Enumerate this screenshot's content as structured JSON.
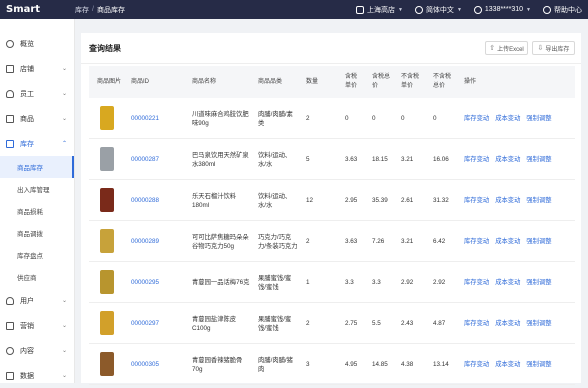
{
  "app": {
    "logo": "Smart"
  },
  "breadcrumb": [
    "库存",
    "商品库存"
  ],
  "header": {
    "store": "上海高店",
    "language": "简体中文",
    "user": "1338****310",
    "help": "帮助中心"
  },
  "sidebar": {
    "items": [
      {
        "label": "概览",
        "icon": "dashboard-icon"
      },
      {
        "label": "店铺",
        "icon": "store-icon"
      },
      {
        "label": "员工",
        "icon": "staff-icon"
      },
      {
        "label": "商品",
        "icon": "goods-icon"
      },
      {
        "label": "库存",
        "icon": "inventory-icon"
      }
    ],
    "sub_items": [
      "商品库存",
      "出入库管理",
      "商品损耗",
      "商品调拨",
      "库存盘点",
      "供应商"
    ],
    "lower_items": [
      {
        "label": "用户",
        "icon": "user-icon"
      },
      {
        "label": "营销",
        "icon": "marketing-icon"
      },
      {
        "label": "内容",
        "icon": "content-icon"
      },
      {
        "label": "数据",
        "icon": "data-icon"
      }
    ]
  },
  "main": {
    "title": "查询结果",
    "upload_label": "上传Excel",
    "export_label": "导出库存",
    "columns": [
      "商品图片",
      "商品ID",
      "商品名称",
      "商品品类",
      "数量",
      "含税\n单价",
      "含税总\n价",
      "不含税\n单价",
      "不含税\n总价",
      "操作"
    ],
    "actions": [
      "库存变动",
      "成本变动",
      "强制调整"
    ],
    "rows": [
      {
        "id": "00000221",
        "name": "川道味麻合鸡肢饮肥\n味90g",
        "category": "肉脯/肉脯/素\n类",
        "qty": "2",
        "tax_unit": "0",
        "tax_total": "0",
        "notax_unit": "0",
        "notax_total": "0",
        "img_color": "#d8a820"
      },
      {
        "id": "00000287",
        "name": "巴马泉饮用天然矿泉\n水380ml",
        "category": "饮料/运动、\n水/水",
        "qty": "5",
        "tax_unit": "3.63",
        "tax_total": "18.15",
        "notax_unit": "3.21",
        "notax_total": "16.06",
        "img_color": "#9aa0a6"
      },
      {
        "id": "00000288",
        "name": "乐天石榴汁饮料\n180ml",
        "category": "饮料/运动、\n水/水",
        "qty": "12",
        "tax_unit": "2.95",
        "tax_total": "35.39",
        "notax_unit": "2.61",
        "notax_total": "31.32",
        "img_color": "#7a2a1a"
      },
      {
        "id": "00000289",
        "name": "可可比萨焦糖玛朵朵\n谷物巧克力50g",
        "category": "巧克力/巧克\n力/条装巧克力",
        "qty": "2",
        "tax_unit": "3.63",
        "tax_total": "7.26",
        "notax_unit": "3.21",
        "notax_total": "6.42",
        "img_color": "#c7a23a"
      },
      {
        "id": "00000295",
        "name": "青蔓园一品话梅76克",
        "category": "果脯蜜饯/蜜\n饯/蜜饯",
        "qty": "1",
        "tax_unit": "3.3",
        "tax_total": "3.3",
        "notax_unit": "2.92",
        "notax_total": "2.92",
        "img_color": "#b8952e"
      },
      {
        "id": "00000297",
        "name": "青蔓园盐津陈皮\nC100g",
        "category": "果脯蜜饯/蜜\n饯/蜜饯",
        "qty": "2",
        "tax_unit": "2.75",
        "tax_total": "5.5",
        "notax_unit": "2.43",
        "notax_total": "4.87",
        "img_color": "#d2a02a"
      },
      {
        "id": "00000305",
        "name": "青蔓园香辣猪脆骨\n70g",
        "category": "肉脯/肉脯/猪\n肉",
        "qty": "3",
        "tax_unit": "4.95",
        "tax_total": "14.85",
        "notax_unit": "4.38",
        "notax_total": "13.14",
        "img_color": "#8c5a2a"
      }
    ]
  }
}
